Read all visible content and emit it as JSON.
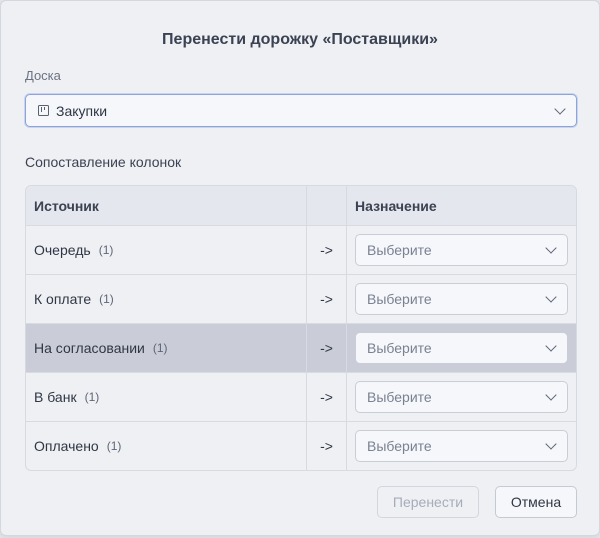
{
  "dialog": {
    "title": "Перенести дорожку «Поставщики»",
    "board_label": "Доска",
    "board_value": "Закупки",
    "mapping_label": "Сопоставление колонок",
    "table": {
      "headers": {
        "source": "Источник",
        "arrow": "",
        "destination": "Назначение"
      },
      "rows": [
        {
          "source": "Очередь",
          "count": "(1)",
          "arrow": "->",
          "placeholder": "Выберите"
        },
        {
          "source": "К оплате",
          "count": "(1)",
          "arrow": "->",
          "placeholder": "Выберите"
        },
        {
          "source": "На согласовании",
          "count": "(1)",
          "arrow": "->",
          "placeholder": "Выберите",
          "highlighted": true
        },
        {
          "source": "В банк",
          "count": "(1)",
          "arrow": "->",
          "placeholder": "Выберите"
        },
        {
          "source": "Оплачено",
          "count": "(1)",
          "arrow": "->",
          "placeholder": "Выберите"
        }
      ]
    },
    "buttons": {
      "move": "Перенести",
      "cancel": "Отмена"
    }
  },
  "icons": {
    "board": "board-icon",
    "dropdown": "chevron-down-icon"
  },
  "colors": {
    "accent_border": "#8ea3d8",
    "row_highlight": "#cacdd8",
    "dialog_bg": "#eff0f4"
  }
}
